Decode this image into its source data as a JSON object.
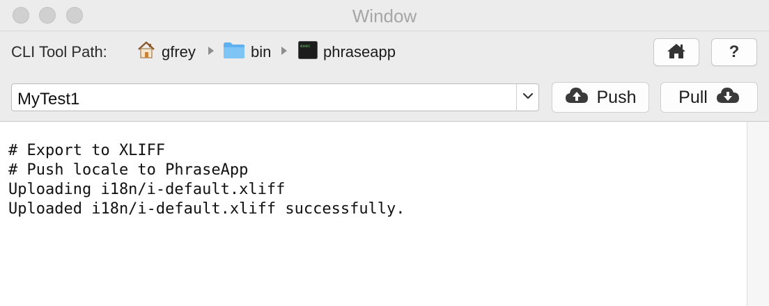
{
  "window": {
    "title": "Window"
  },
  "toolbar": {
    "path_label": "CLI Tool Path:",
    "breadcrumb": [
      {
        "label": "gfrey",
        "icon": "home-folder-icon"
      },
      {
        "label": "bin",
        "icon": "folder-icon"
      },
      {
        "label": "phraseapp",
        "icon": "terminal-executable-icon"
      }
    ],
    "home_button_icon": "home-icon",
    "help_button_label": "?"
  },
  "project": {
    "selected": "MyTest1",
    "dropdown_icon": "chevron-down-icon"
  },
  "actions": {
    "push_label": "Push",
    "push_icon": "cloud-upload-icon",
    "pull_label": "Pull",
    "pull_icon": "cloud-download-icon"
  },
  "console": {
    "lines": [
      "# Export to XLIFF",
      "# Push locale to PhraseApp",
      "Uploading i18n/i-default.xliff",
      "Uploaded i18n/i-default.xliff successfully."
    ]
  },
  "colors": {
    "window_bg": "#ececec",
    "console_bg": "#ffffff",
    "icon_dark": "#3a3a3a",
    "folder_blue": "#6cb8f0"
  }
}
